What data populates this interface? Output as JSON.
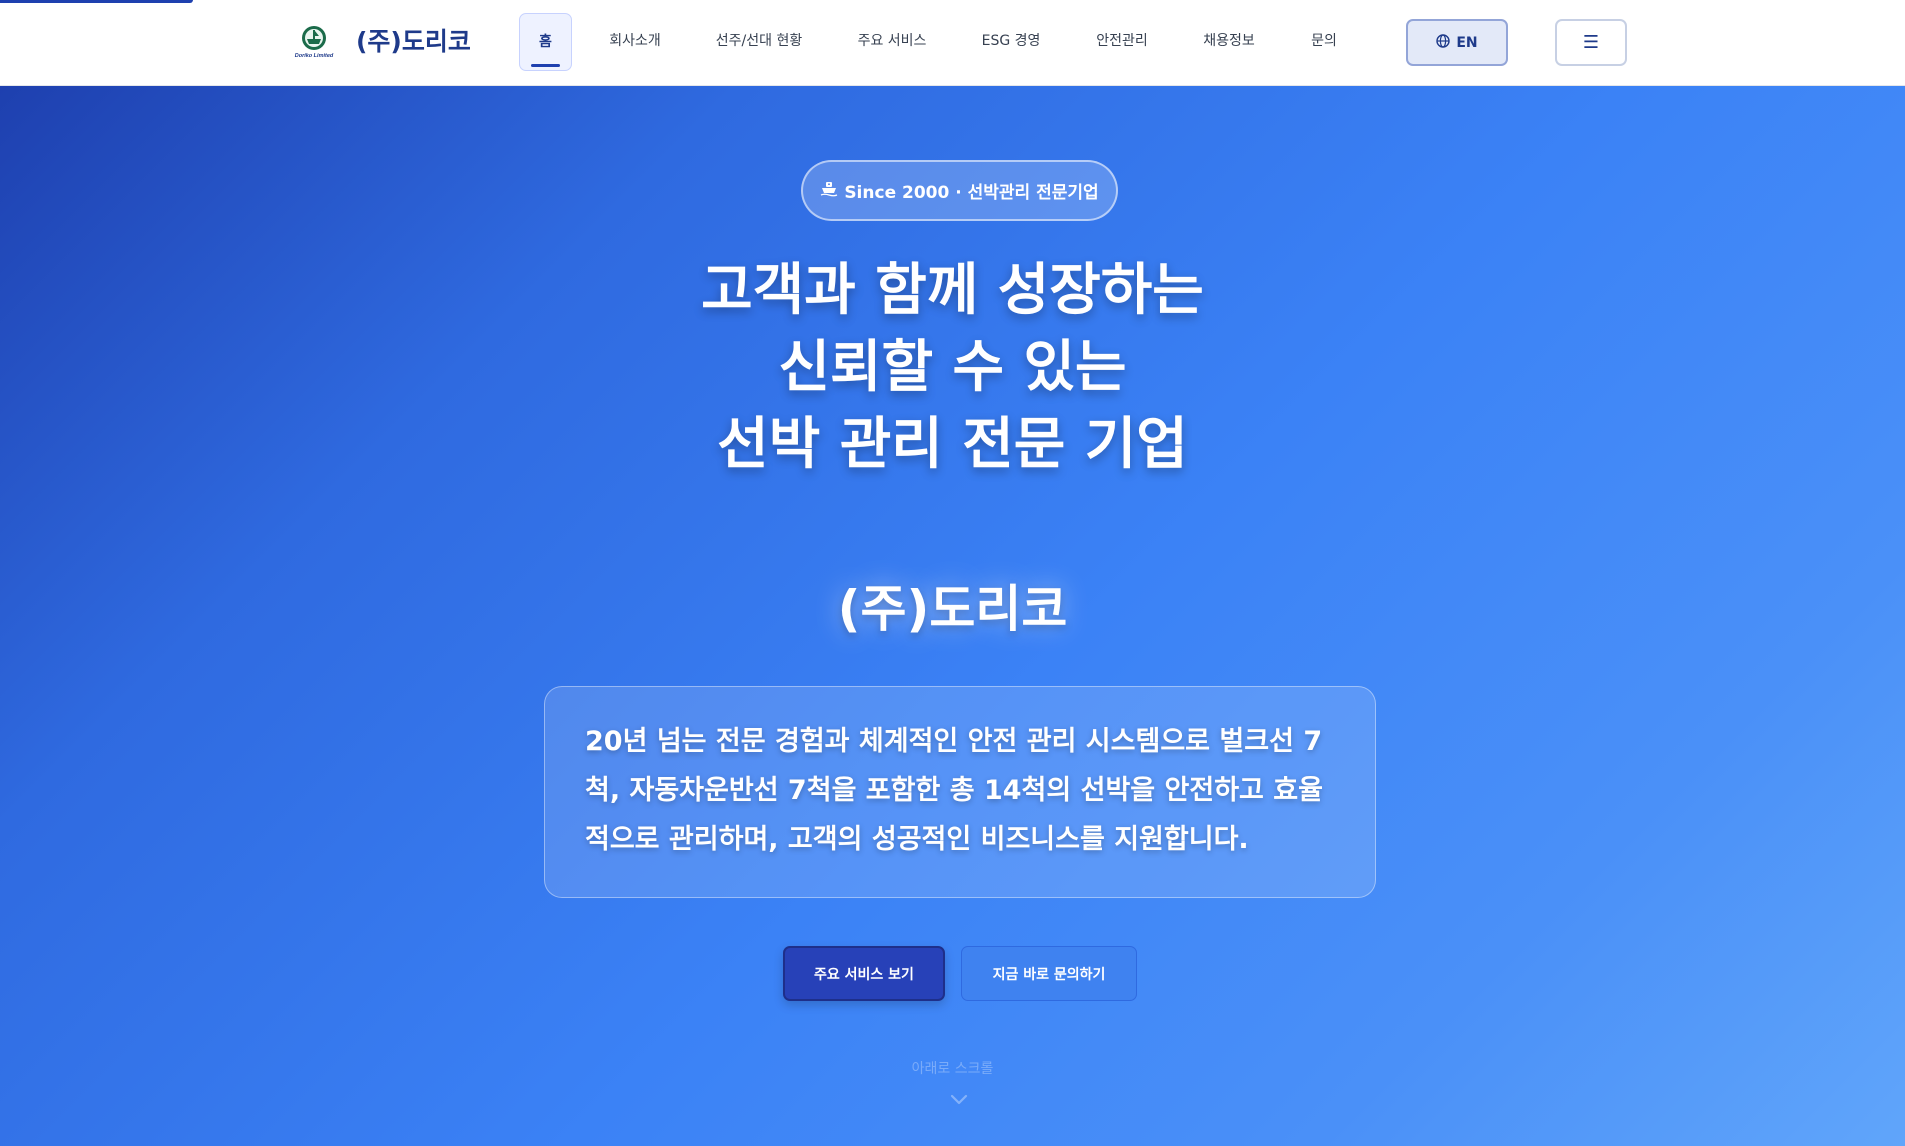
{
  "page": {
    "brand": "(주)도리코",
    "logo_caption": "Doriko Limited"
  },
  "nav": {
    "items": [
      {
        "label": "홈"
      },
      {
        "label": "회사소개"
      },
      {
        "label": "선주/선대 현황"
      },
      {
        "label": "주요 서비스"
      },
      {
        "label": "ESG 경영"
      },
      {
        "label": "안전관리"
      },
      {
        "label": "채용정보"
      },
      {
        "label": "문의"
      }
    ],
    "active_index": 0,
    "lang_label": "EN",
    "lang_icon": "globe-icon",
    "menu_icon": "☰"
  },
  "hero": {
    "badge_icon": "ship-icon",
    "badge_text": "Since 2000 · 선박관리 전문기업",
    "headline": [
      "고객과 함께 성장하는",
      "신뢰할 수 있는",
      "선박 관리 전문 기업"
    ],
    "company": "(주)도리코",
    "description": "20년 넘는 전문 경험과 체계적인 안전 관리 시스템으로 벌크선 7척, 자동차운반선 7척을 포함한 총 14척의 선박을 안전하고 효율적으로 관리하며, 고객의 성공적인 비즈니스를 지원합니다.",
    "primary_button": "주요 서비스 보기",
    "secondary_button": "지금 바로 문의하기",
    "scroll_hint": "아래로 스크롤",
    "scroll_icon": "chevron-down-icon"
  },
  "colors": {
    "brand_navy": "#1e3a8a",
    "accent": "#1e40af",
    "hero_start": "#1e40af",
    "hero_end": "#60a5fa"
  }
}
